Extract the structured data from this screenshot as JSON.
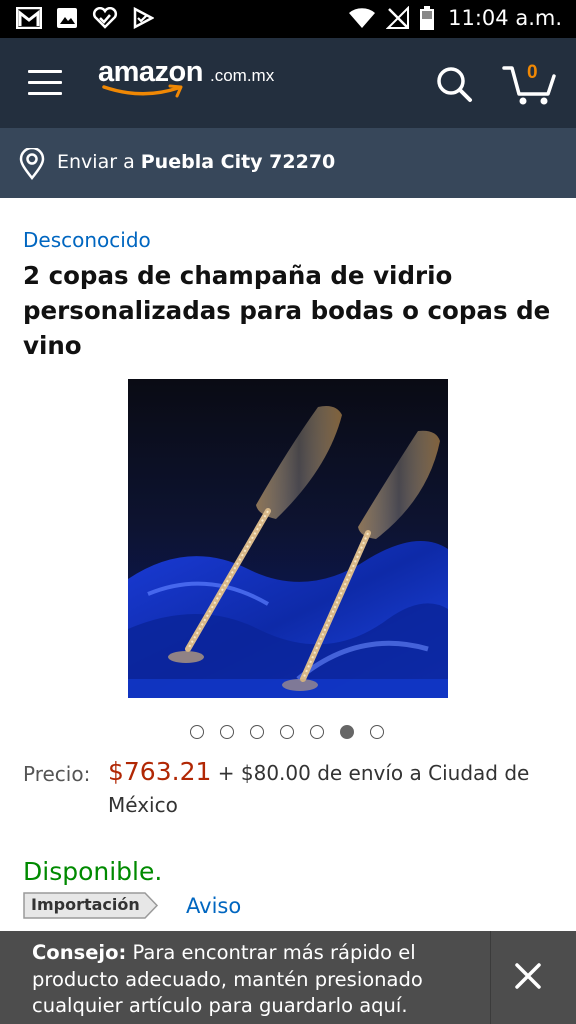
{
  "status_bar": {
    "time": "11:04 a.m.",
    "left_icons": [
      "gmail-icon",
      "image-icon",
      "heart-check-icon",
      "play-check-icon"
    ],
    "right_icons": [
      "wifi-icon",
      "no-signal-icon",
      "battery-icon"
    ]
  },
  "header": {
    "logo_text": "amazon",
    "logo_domain": ".com.mx",
    "cart_count": "0",
    "accent_color": "#f08804",
    "background_color": "#232f3e"
  },
  "deliver": {
    "prefix": "Enviar a ",
    "location": "Puebla City 72270"
  },
  "product": {
    "brand": "Desconocido",
    "title": "2 copas de champaña de vidrio personalizadas para bodas o copas de vino",
    "image_count": 7,
    "active_image_index": 6,
    "price_label": "Precio:",
    "price": "$763.21",
    "shipping": " + $80.00 de envío a Ciudad de México",
    "availability": "Disponible.",
    "import_badge": "Importación",
    "notice_link": "Aviso"
  },
  "toast": {
    "bold": "Consejo:",
    "message": " Para encontrar más rápido el producto adecuado, mantén presionado cualquier artículo para guardarlo aquí."
  }
}
